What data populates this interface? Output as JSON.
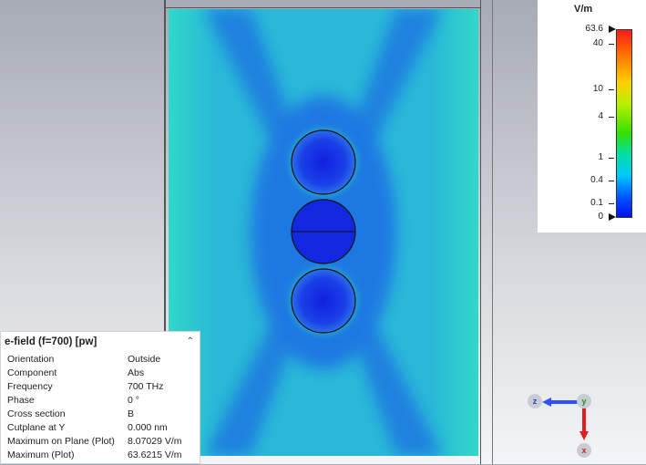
{
  "legend": {
    "unit": "V/m",
    "ticks": [
      "63.6",
      "40",
      "10",
      "4",
      "1",
      "0.4",
      "0.1",
      "0"
    ]
  },
  "info_panel": {
    "title": "e-field (f=700) [pw]",
    "rows": [
      {
        "key": "Orientation",
        "value": "Outside"
      },
      {
        "key": "Component",
        "value": "Abs"
      },
      {
        "key": "Frequency",
        "value": "700 THz"
      },
      {
        "key": "Phase",
        "value": "0 °"
      },
      {
        "key": "Cross section",
        "value": "B"
      },
      {
        "key": "Cutplane at Y",
        "value": "0.000 nm"
      },
      {
        "key": "Maximum on Plane (Plot)",
        "value": "8.07029 V/m"
      },
      {
        "key": "Maximum (Plot)",
        "value": "63.6215 V/m"
      }
    ]
  },
  "axes": {
    "z": "z",
    "y": "y",
    "x": "x"
  },
  "colors": {
    "background_field": "#2ab8d8",
    "low_field": "#1030e0",
    "axis_z": "#3050ff",
    "axis_x": "#e02020"
  }
}
